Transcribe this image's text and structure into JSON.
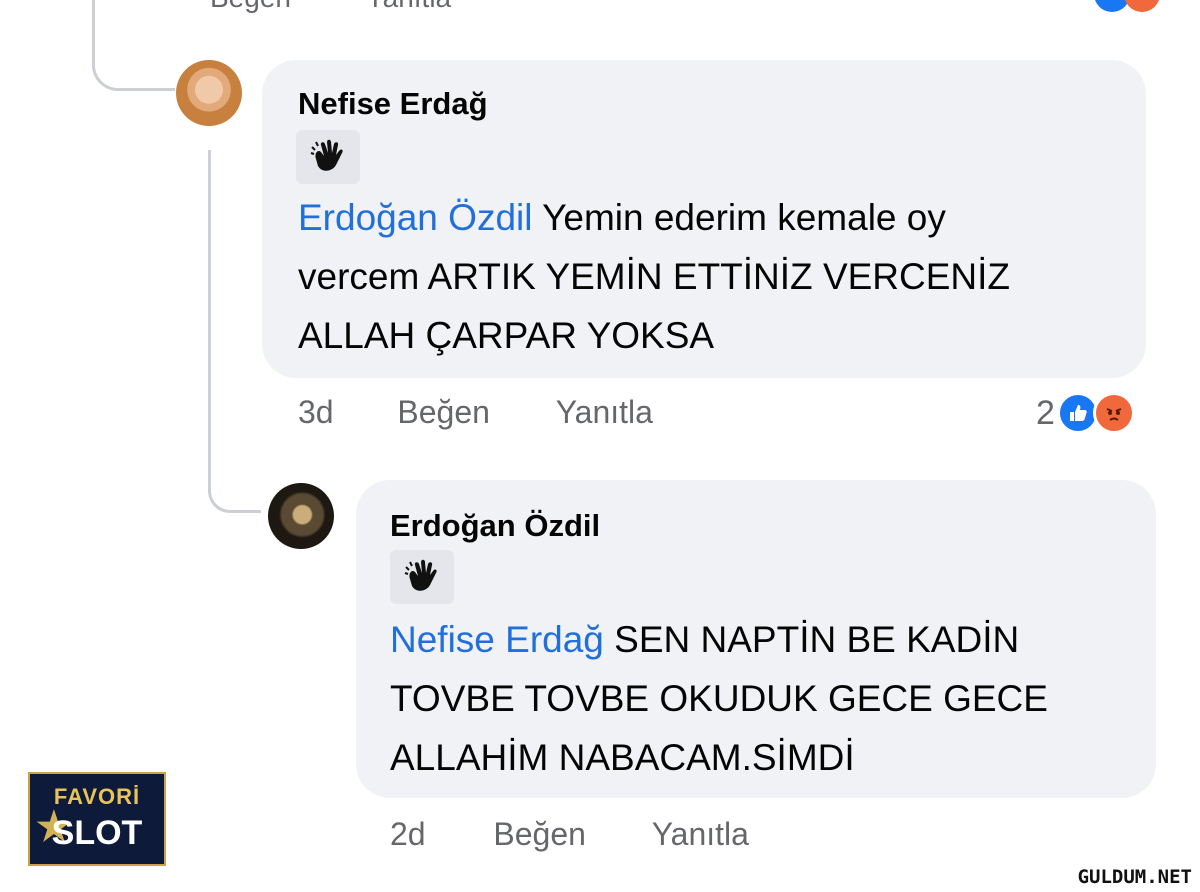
{
  "top_row": {
    "like_label": "Beğen",
    "reply_label": "Yanıtla"
  },
  "comments": [
    {
      "author": "Nefise Erdağ",
      "mention": "Erdoğan Özdil",
      "text_line1": " Yemin ederim kemale oy",
      "text_line2": "vercem ARTIK YEMİN ETTİNİZ VERCENİZ",
      "text_line3": "ALLAH ÇARPAR YOKSA",
      "time": "3d",
      "like_label": "Beğen",
      "reply_label": "Yanıtla",
      "reaction_count": "2"
    },
    {
      "author": "Erdoğan Özdil",
      "mention": "Nefise Erdağ",
      "text_line1": " SEN NAPTİN BE KADİN",
      "text_line2": "TOVBE TOVBE OKUDUK GECE GECE",
      "text_line3": "ALLAHİM NABACAM.SİMDİ",
      "time": "2d",
      "like_label": "Beğen",
      "reply_label": "Yanıtla"
    }
  ],
  "logo": {
    "top": "FAVORİ",
    "bottom": "SLOT"
  },
  "watermark": "GULDUM.NET",
  "colors": {
    "mention": "#216fdb",
    "bubble": "#f0f2f5",
    "meta": "#65676b",
    "like": "#1877f2",
    "angry": "#f0683b"
  }
}
